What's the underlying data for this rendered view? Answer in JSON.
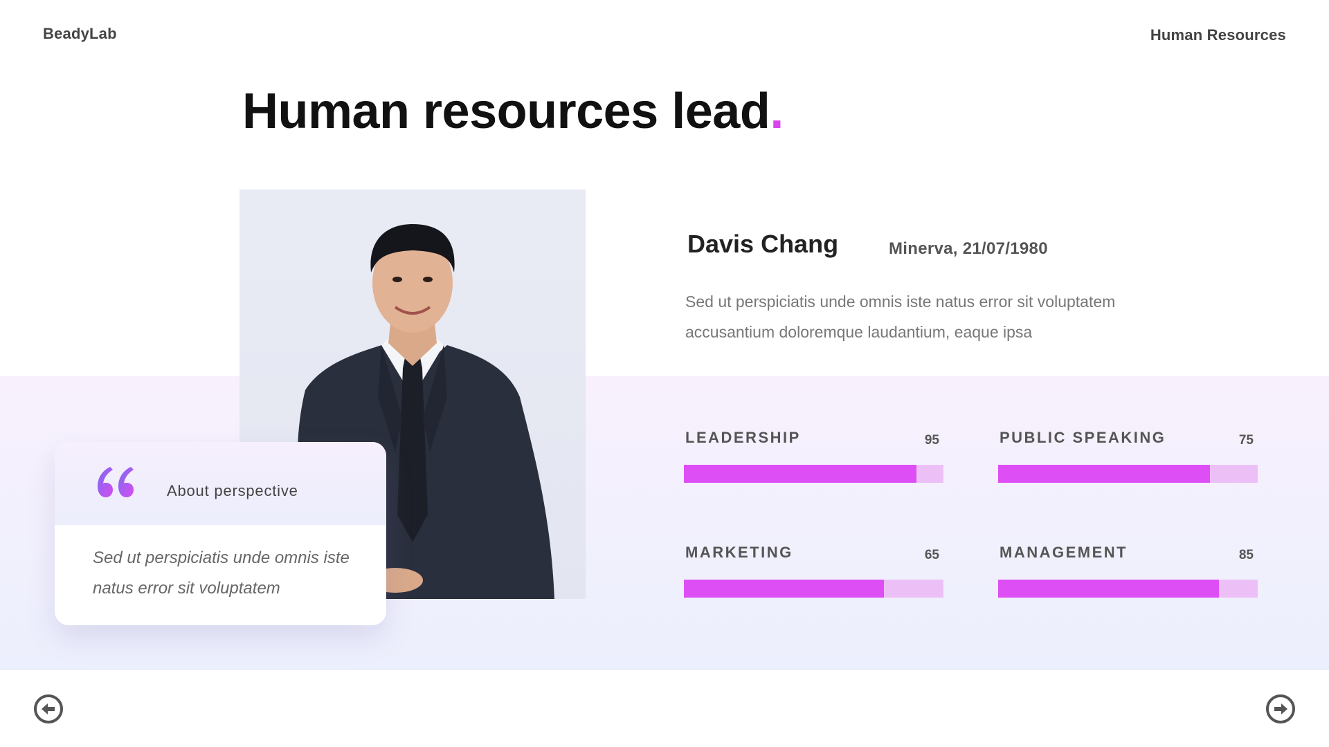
{
  "header": {
    "brand": "BeadyLab",
    "section": "Human Resources"
  },
  "title": {
    "text": "Human resources lead",
    "dot": "."
  },
  "profile": {
    "name": "Davis Chang",
    "meta": "Minerva, 21/07/1980",
    "description": "Sed ut perspiciatis unde omnis iste natus error sit voluptatem accusantium doloremque laudantium, eaque ipsa"
  },
  "quote": {
    "title": "About perspective",
    "text": "Sed ut perspiciatis unde omnis iste natus error sit voluptatem"
  },
  "skills": [
    {
      "label": "LEADERSHIP",
      "value": "95",
      "level": 0.895
    },
    {
      "label": "PUBLIC SPEAKING",
      "value": "75",
      "level": 0.815
    },
    {
      "label": "MARKETING",
      "value": "65",
      "level": 0.77
    },
    {
      "label": "MANAGEMENT",
      "value": "85",
      "level": 0.85
    }
  ],
  "colors": {
    "accent": "#d946ef",
    "bar_fill": "#dd4ff5",
    "bar_track": "#ecc0f7"
  },
  "icons": {
    "prev": "arrow-left-circle-icon",
    "next": "arrow-right-circle-icon",
    "quote": "quote-icon"
  }
}
